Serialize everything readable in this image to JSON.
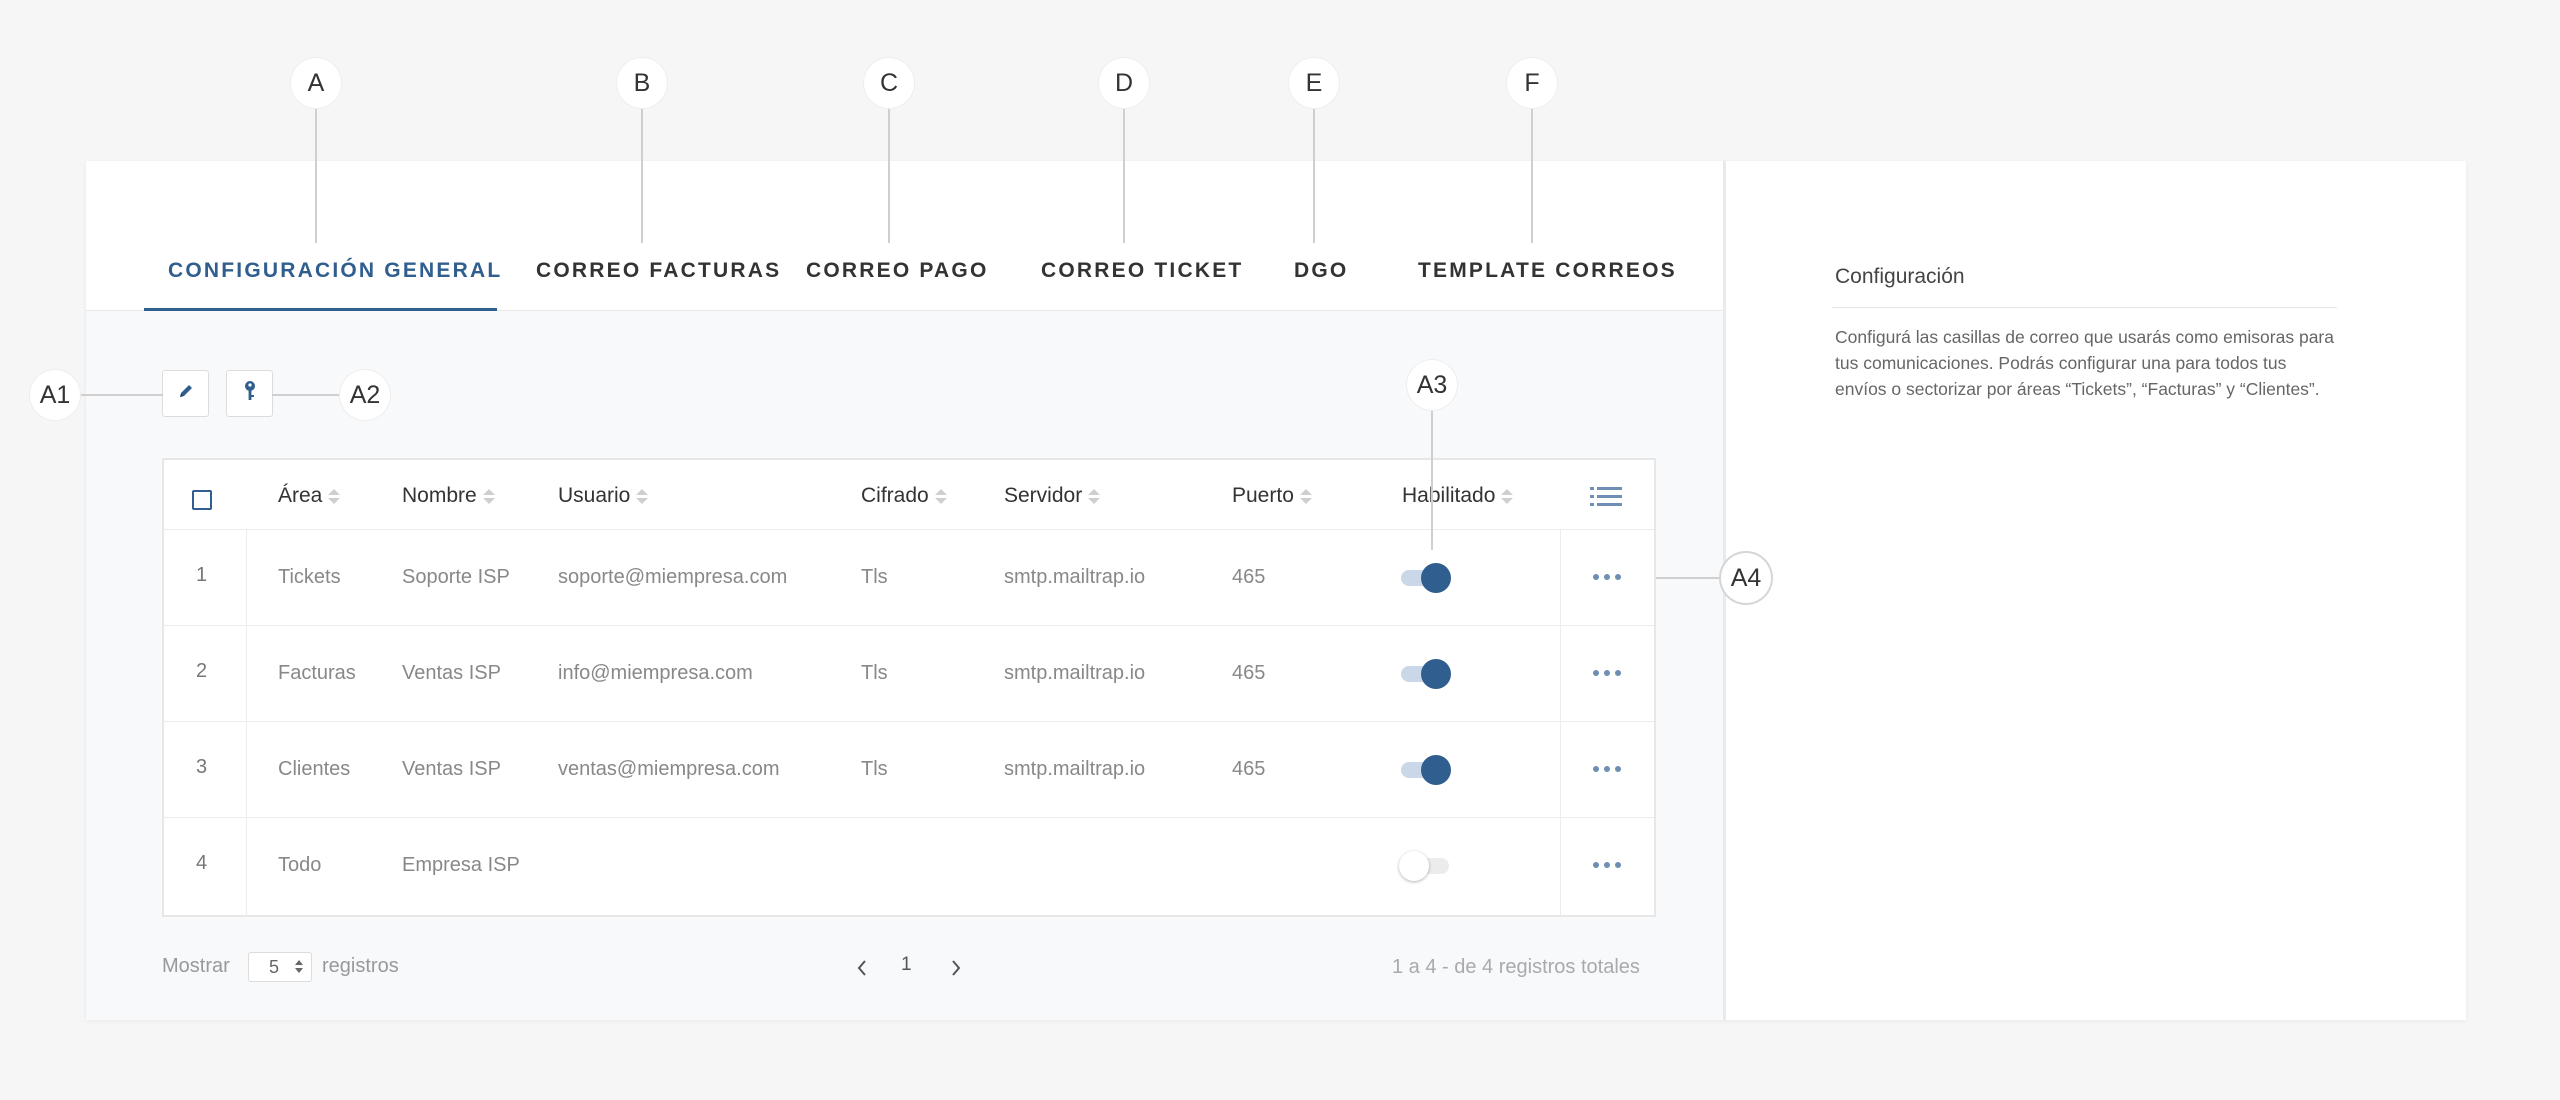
{
  "callouts": {
    "A": "A",
    "B": "B",
    "C": "C",
    "D": "D",
    "E": "E",
    "F": "F",
    "A1": "A1",
    "A2": "A2",
    "A3": "A3",
    "A4": "A4"
  },
  "tabs": [
    {
      "label": "CONFIGURACIÓN GENERAL",
      "active": true
    },
    {
      "label": "CORREO FACTURAS"
    },
    {
      "label": "CORREO PAGO"
    },
    {
      "label": "CORREO TICKET"
    },
    {
      "label": "DGO"
    },
    {
      "label": "TEMPLATE CORREOS"
    }
  ],
  "toolbar": {
    "edit_icon": "pencil-icon",
    "key_icon": "key-icon"
  },
  "table": {
    "columns": [
      "Área",
      "Nombre",
      "Usuario",
      "Cifrado",
      "Servidor",
      "Puerto",
      "Habilitado"
    ],
    "column_menu_icon": "list-icon",
    "rows": [
      {
        "index": "1",
        "area": "Tickets",
        "nombre": "Soporte ISP",
        "usuario": "soporte@miempresa.com",
        "cifrado": "Tls",
        "servidor": "smtp.mailtrap.io",
        "puerto": "465",
        "habilitado": true
      },
      {
        "index": "2",
        "area": "Facturas",
        "nombre": "Ventas ISP",
        "usuario": "info@miempresa.com",
        "cifrado": "Tls",
        "servidor": "smtp.mailtrap.io",
        "puerto": "465",
        "habilitado": true
      },
      {
        "index": "3",
        "area": "Clientes",
        "nombre": "Ventas ISP",
        "usuario": "ventas@miempresa.com",
        "cifrado": "Tls",
        "servidor": "smtp.mailtrap.io",
        "puerto": "465",
        "habilitado": true
      },
      {
        "index": "4",
        "area": "Todo",
        "nombre": "Empresa ISP",
        "usuario": "",
        "cifrado": "",
        "servidor": "",
        "puerto": "",
        "habilitado": false
      }
    ]
  },
  "pagination": {
    "show_label": "Mostrar",
    "page_size": "5",
    "records_label": "registros",
    "current_page": "1",
    "summary": "1 a 4 - de 4 registros totales"
  },
  "sidebar": {
    "title": "Configuración",
    "description": "Configurá las casillas de correo que usarás como emisoras para tus comunicaciones. Podrás configurar una para todos tus envíos o sectorizar por áreas “Tickets”, “Facturas” y “Clientes”."
  },
  "colors": {
    "accent": "#2f5e8f",
    "toggle_track_on": "#c9d7e8",
    "dots": "#6e8eb5"
  }
}
